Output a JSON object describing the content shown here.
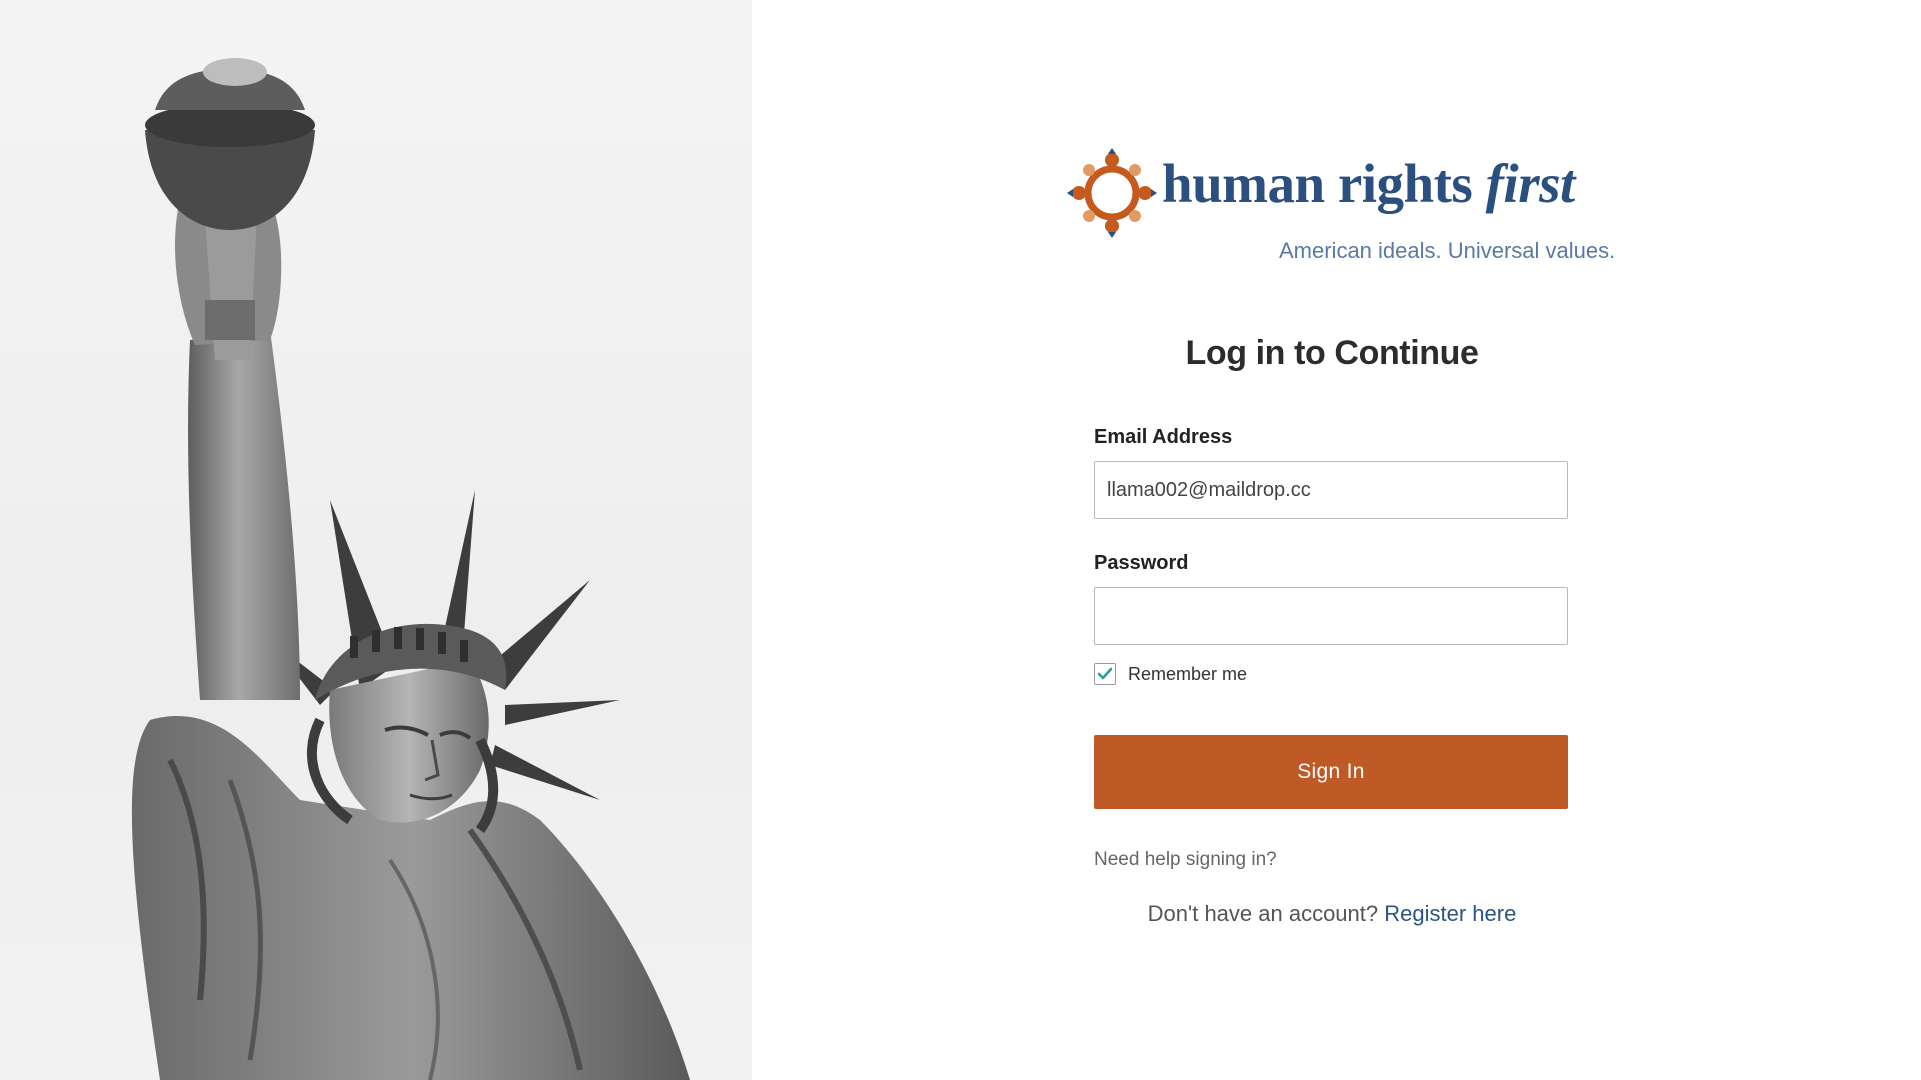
{
  "brand": {
    "name_part1": "human rights ",
    "name_part2": "first",
    "tagline": "American ideals. Universal values.",
    "logo_colors": {
      "orange": "#c45a1e",
      "blue": "#2b4f7f"
    }
  },
  "hero_image": {
    "icon": "statue-of-liberty-photo"
  },
  "form": {
    "title": "Log in to Continue",
    "email_label": "Email Address",
    "email_value": "llama002@maildrop.cc",
    "password_label": "Password",
    "password_value": "",
    "remember_label": "Remember me",
    "remember_checked": true,
    "signin_label": "Sign In",
    "help_link": "Need help signing in?",
    "register_prompt": "Don't have an account?",
    "register_link": "Register here"
  },
  "colors": {
    "button": "#bf5a26",
    "link": "#2b5585",
    "checkmark": "#2a9d8f"
  }
}
